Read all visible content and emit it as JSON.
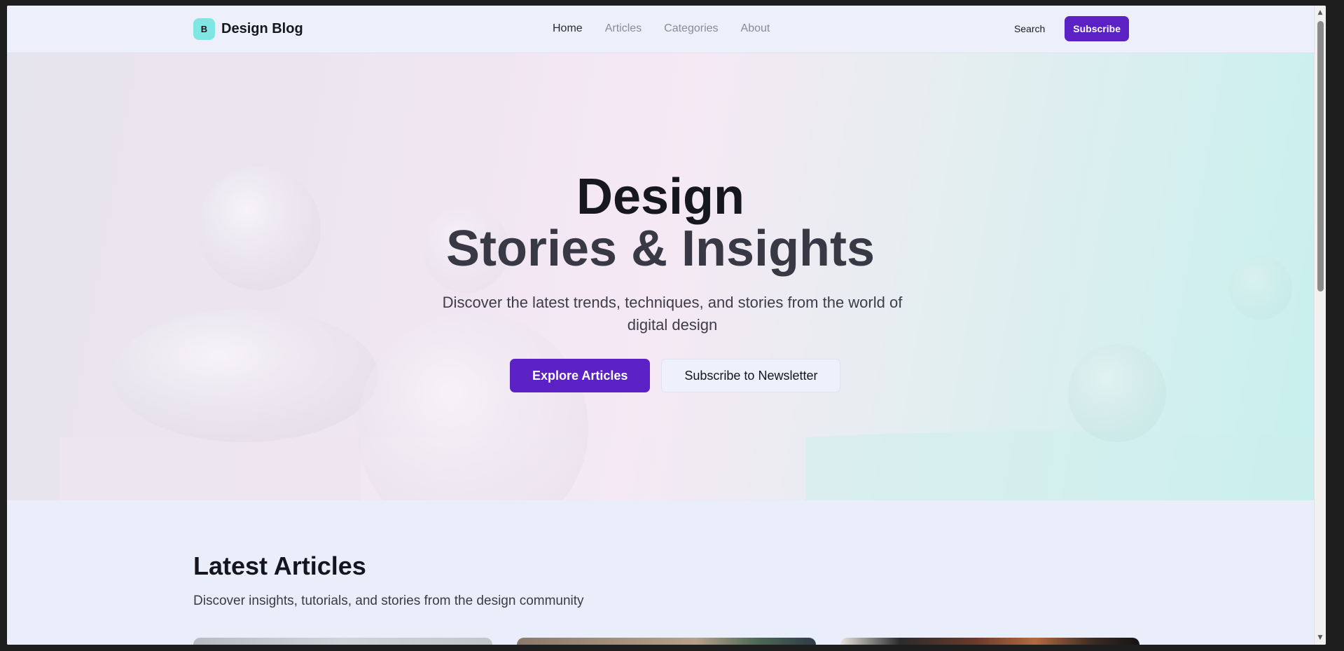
{
  "header": {
    "logo_letter": "B",
    "brand_name": "Design Blog",
    "nav": [
      {
        "label": "Home"
      },
      {
        "label": "Articles"
      },
      {
        "label": "Categories"
      },
      {
        "label": "About"
      }
    ],
    "search_label": "Search",
    "subscribe_label": "Subscribe"
  },
  "hero": {
    "title_line1": "Design",
    "title_line2": "Stories & Insights",
    "subtitle": "Discover the latest trends, techniques, and stories from the world of digital design",
    "primary_button": "Explore Articles",
    "secondary_button": "Subscribe to Newsletter"
  },
  "latest": {
    "title": "Latest Articles",
    "subtitle": "Discover insights, tutorials, and stories from the design community"
  },
  "colors": {
    "accent": "#5b21c4",
    "logo_bg": "#7fe6e3",
    "page_bg": "#eaeefb",
    "heading": "#15151f"
  },
  "icons": {
    "scroll_up": "scroll-up-arrow-icon",
    "scroll_down": "scroll-down-arrow-icon"
  }
}
